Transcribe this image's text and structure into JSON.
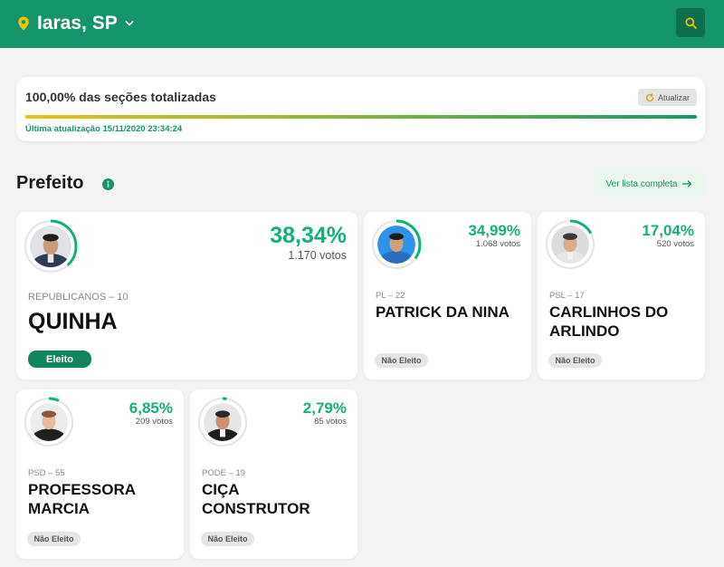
{
  "header": {
    "location": "Iaras, SP",
    "colors": {
      "bar": "#14946a",
      "accent": "#f2c200"
    },
    "icons": {
      "location": "map-pin-icon",
      "dropdown": "chevron-down-icon",
      "search": "search-icon"
    }
  },
  "status": {
    "title": "100,00% das seções totalizadas",
    "progress": 1.0,
    "refresh_label": "Atualizar",
    "last_update": "Última atualização 15/11/2020 23:34:24"
  },
  "section": {
    "title": "Prefeito",
    "full_list_label": "Ver lista completa",
    "icons": {
      "info": "info-icon",
      "arrow": "arrow-right-icon"
    }
  },
  "candidates": [
    {
      "name": "QUINHA",
      "party": "REPUBLICANOS – 10",
      "percent": "38,34%",
      "votes": "1.170 votos",
      "share": 0.3834,
      "status": "Eleito"
    },
    {
      "name": "PATRICK DA NINA",
      "party": "PL – 22",
      "percent": "34,99%",
      "votes": "1.068 votos",
      "share": 0.3499,
      "status": "Não Eleito"
    },
    {
      "name": "CARLINHOS DO ARLINDO",
      "party": "PSL – 17",
      "percent": "17,04%",
      "votes": "520 votos",
      "share": 0.1704,
      "status": "Não Eleito"
    },
    {
      "name": "PROFESSORA MARCIA",
      "party": "PSD – 55",
      "percent": "6,85%",
      "votes": "209 votos",
      "share": 0.0685,
      "status": "Não Eleito"
    },
    {
      "name": "CIÇA CONSTRUTOR",
      "party": "PODE – 19",
      "percent": "2,79%",
      "votes": "85 votos",
      "share": 0.0279,
      "status": "Não Eleito"
    }
  ]
}
